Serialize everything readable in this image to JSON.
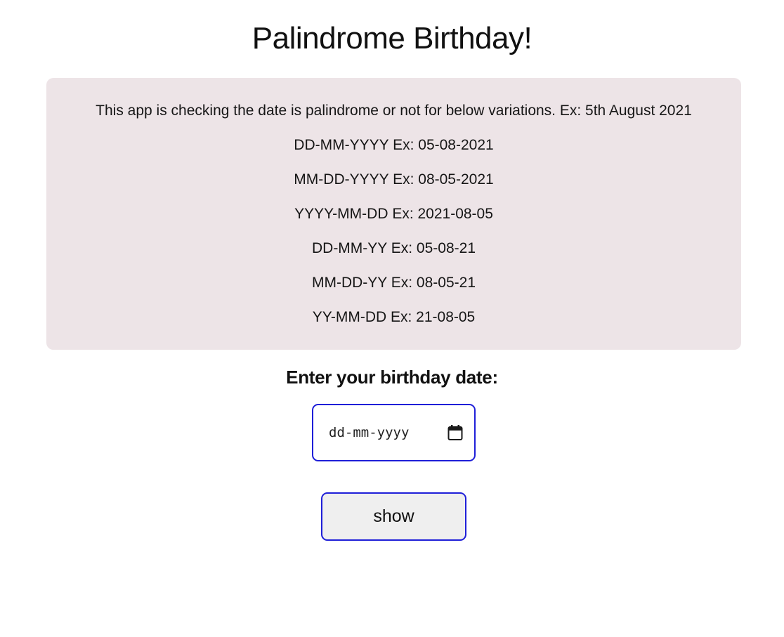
{
  "header": {
    "title": "Palindrome Birthday!"
  },
  "info": {
    "lines": [
      "This app is checking the date is palindrome or not for below variations. Ex: 5th August 2021",
      "DD-MM-YYYY Ex: 05-08-2021",
      "MM-DD-YYYY Ex: 08-05-2021",
      "YYYY-MM-DD Ex: 2021-08-05",
      "DD-MM-YY Ex: 05-08-21",
      "MM-DD-YY Ex: 08-05-21",
      "YY-MM-DD Ex: 21-08-05"
    ]
  },
  "form": {
    "prompt": "Enter your birthday date:",
    "date_placeholder": "dd-mm-yyyy",
    "date_value": "",
    "calendar_icon": "calendar-icon",
    "show_label": "show"
  },
  "colors": {
    "info_background": "#ede4e7",
    "accent_border": "#1f1fd8",
    "button_background": "#efefef"
  }
}
